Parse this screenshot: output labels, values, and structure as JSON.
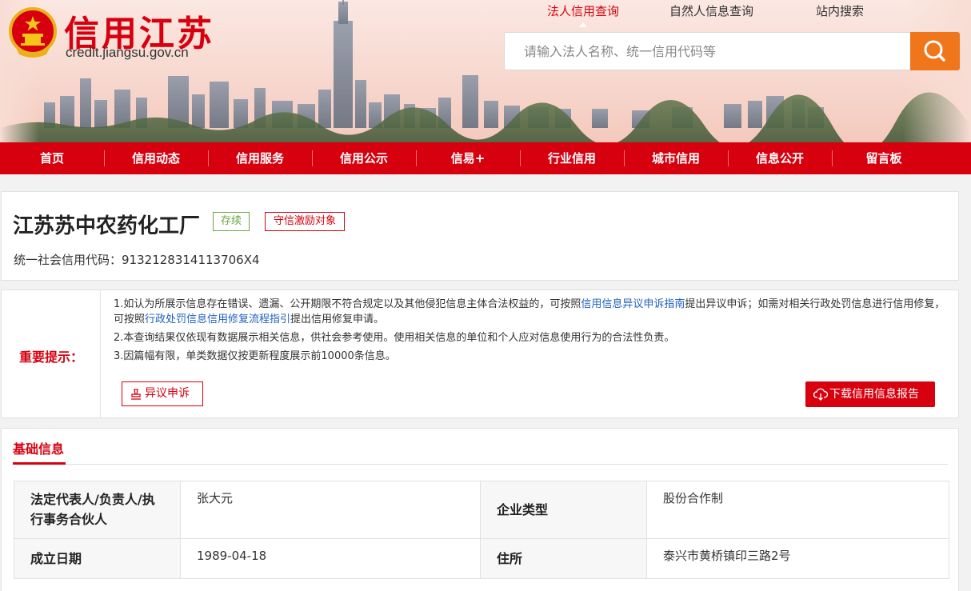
{
  "header": {
    "logo_title": "信用江苏",
    "logo_url": "credit.jiangsu.gov.cn",
    "top_links": [
      {
        "label": "法人信用查询",
        "active": true
      },
      {
        "label": "自然人信息查询",
        "active": false
      },
      {
        "label": "站内搜索",
        "active": false
      }
    ],
    "search": {
      "placeholder": "请输入法人名称、统一信用代码等",
      "value": ""
    }
  },
  "main_nav": [
    "首页",
    "信用动态",
    "信用服务",
    "信用公示",
    "信易+",
    "行业信用",
    "城市信用",
    "信息公开",
    "留言板"
  ],
  "company": {
    "name": "江苏苏中农药化工厂",
    "status_tag": "存续",
    "honor_tag": "守信激励对象",
    "credit_code_label": "统一社会信用代码：",
    "credit_code": "9132128314113706X4"
  },
  "notice": {
    "label": "重要提示：",
    "line1_a": "1.如认为所展示信息存在错误、遗漏、公开期限不符合规定以及其他侵犯信息主体合法权益的，可按照",
    "line1_link1": "信用信息异议申诉指南",
    "line1_b": "提出异议申诉；如需对相关行政处罚信息进行信用修复，可按照",
    "line1_link2": "行政处罚信息信用修复流程指引",
    "line1_c": "提出信用修复申请。",
    "line2": "2.本查询结果仅依现有数据展示相关信息，供社会参考使用。使用相关信息的单位和个人应对信息使用行为的合法性负责。",
    "line3": "3.因篇幅有限，单类数据仅按更新程度展示前10000条信息。",
    "objection_button": "异议申诉",
    "download_button": "下载信用信息报告"
  },
  "basic_info": {
    "section_title": "基础信息",
    "rows": [
      {
        "k1": "法定代表人/负责人/执行事务合伙人",
        "v1": "张大元",
        "k2": "企业类型",
        "v2": "股份合作制"
      },
      {
        "k1": "成立日期",
        "v1": "1989-04-18",
        "k2": "住所",
        "v2": "泰兴市黄桥镇印三路2号"
      }
    ]
  },
  "colors": {
    "brand_red": "#d7000f",
    "search_orange": "#f0761c",
    "tag_green": "#6ba642",
    "link_blue": "#1f5fbf"
  }
}
